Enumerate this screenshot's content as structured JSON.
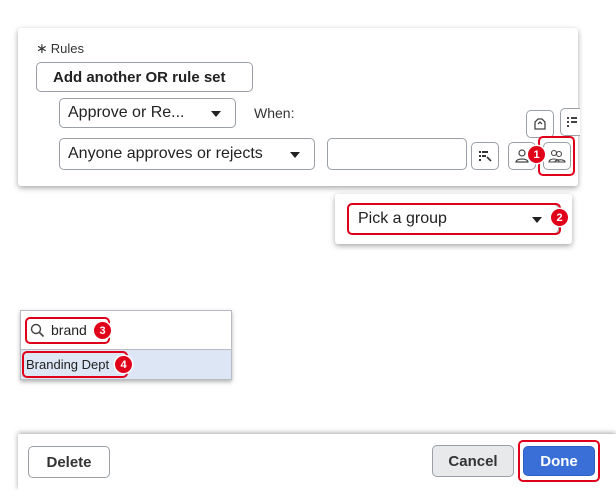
{
  "rules": {
    "label": "Rules",
    "add_or_button": "Add another OR rule set",
    "approval_type": "Approve or Re...",
    "when_label": "When:",
    "condition": "Anyone approves or rejects",
    "value": ""
  },
  "group_picker": {
    "placeholder": "Pick a group"
  },
  "search": {
    "query": "brand",
    "results": [
      "Branding Dept"
    ]
  },
  "footer": {
    "delete": "Delete",
    "cancel": "Cancel",
    "done": "Done"
  },
  "annotations": [
    "1",
    "2",
    "3",
    "4"
  ],
  "colors": {
    "highlight": "#e0001a",
    "primary": "#3a6fd8",
    "selected_row": "#dce6f5"
  }
}
